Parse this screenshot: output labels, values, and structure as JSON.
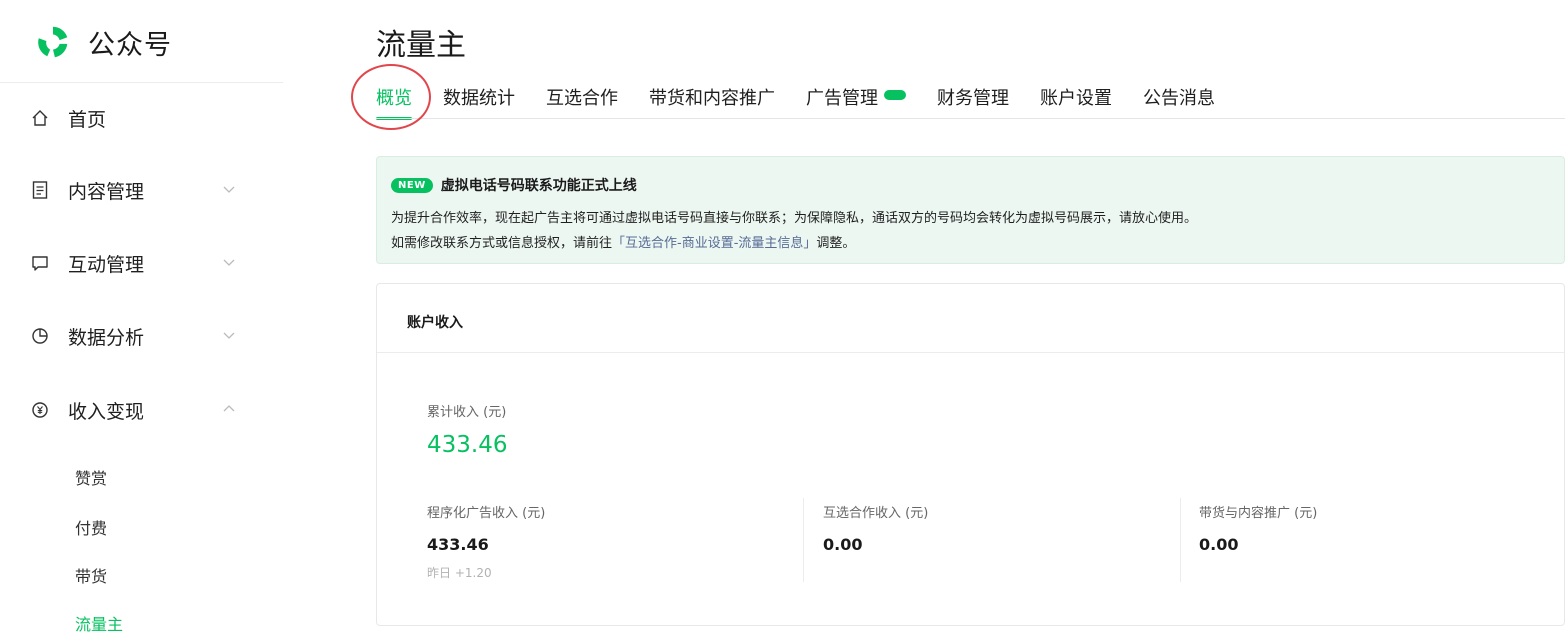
{
  "brand": {
    "name": "公众号",
    "color": "#07c160"
  },
  "sidebar": {
    "items": [
      {
        "label": "首页",
        "icon": "home-icon"
      },
      {
        "label": "内容管理",
        "icon": "document-icon",
        "expandable": true,
        "expanded": false
      },
      {
        "label": "互动管理",
        "icon": "chat-icon",
        "expandable": true,
        "expanded": false
      },
      {
        "label": "数据分析",
        "icon": "pie-chart-icon",
        "expandable": true,
        "expanded": false
      },
      {
        "label": "收入变现",
        "icon": "yen-coin-icon",
        "expandable": true,
        "expanded": true
      }
    ],
    "subitems": [
      {
        "label": "赞赏",
        "active": false
      },
      {
        "label": "付费",
        "active": false
      },
      {
        "label": "带货",
        "active": false
      },
      {
        "label": "流量主",
        "active": true
      }
    ]
  },
  "main": {
    "title": "流量主",
    "tabs": [
      {
        "label": "概览",
        "active": true
      },
      {
        "label": "数据统计"
      },
      {
        "label": "互选合作"
      },
      {
        "label": "带货和内容推广"
      },
      {
        "label": "广告管理",
        "has_new": true
      },
      {
        "label": "财务管理"
      },
      {
        "label": "账户设置"
      },
      {
        "label": "公告消息"
      }
    ],
    "notice": {
      "badge": "NEW",
      "title": "虚拟电话号码联系功能正式上线",
      "line1": "为提升合作效率，现在起广告主将可通过虚拟电话号码直接与你联系；为保障隐私，通话双方的号码均会转化为虚拟号码展示，请放心使用。",
      "line2_prefix": "如需修改联系方式或信息授权，请前往",
      "line2_link": "「互选合作-商业设置-流量主信息」",
      "line2_suffix": "调整。"
    },
    "income": {
      "title": "账户收入",
      "total_label": "累计收入 (元)",
      "total_value": "433.46",
      "metrics": [
        {
          "label": "程序化广告收入 (元)",
          "value": "433.46",
          "sub": "昨日 +1.20"
        },
        {
          "label": "互选合作收入 (元)",
          "value": "0.00"
        },
        {
          "label": "带货与内容推广 (元)",
          "value": "0.00"
        }
      ]
    }
  },
  "colors": {
    "accent": "#07c160",
    "annotation": "#e0474c",
    "link": "#576b95"
  }
}
